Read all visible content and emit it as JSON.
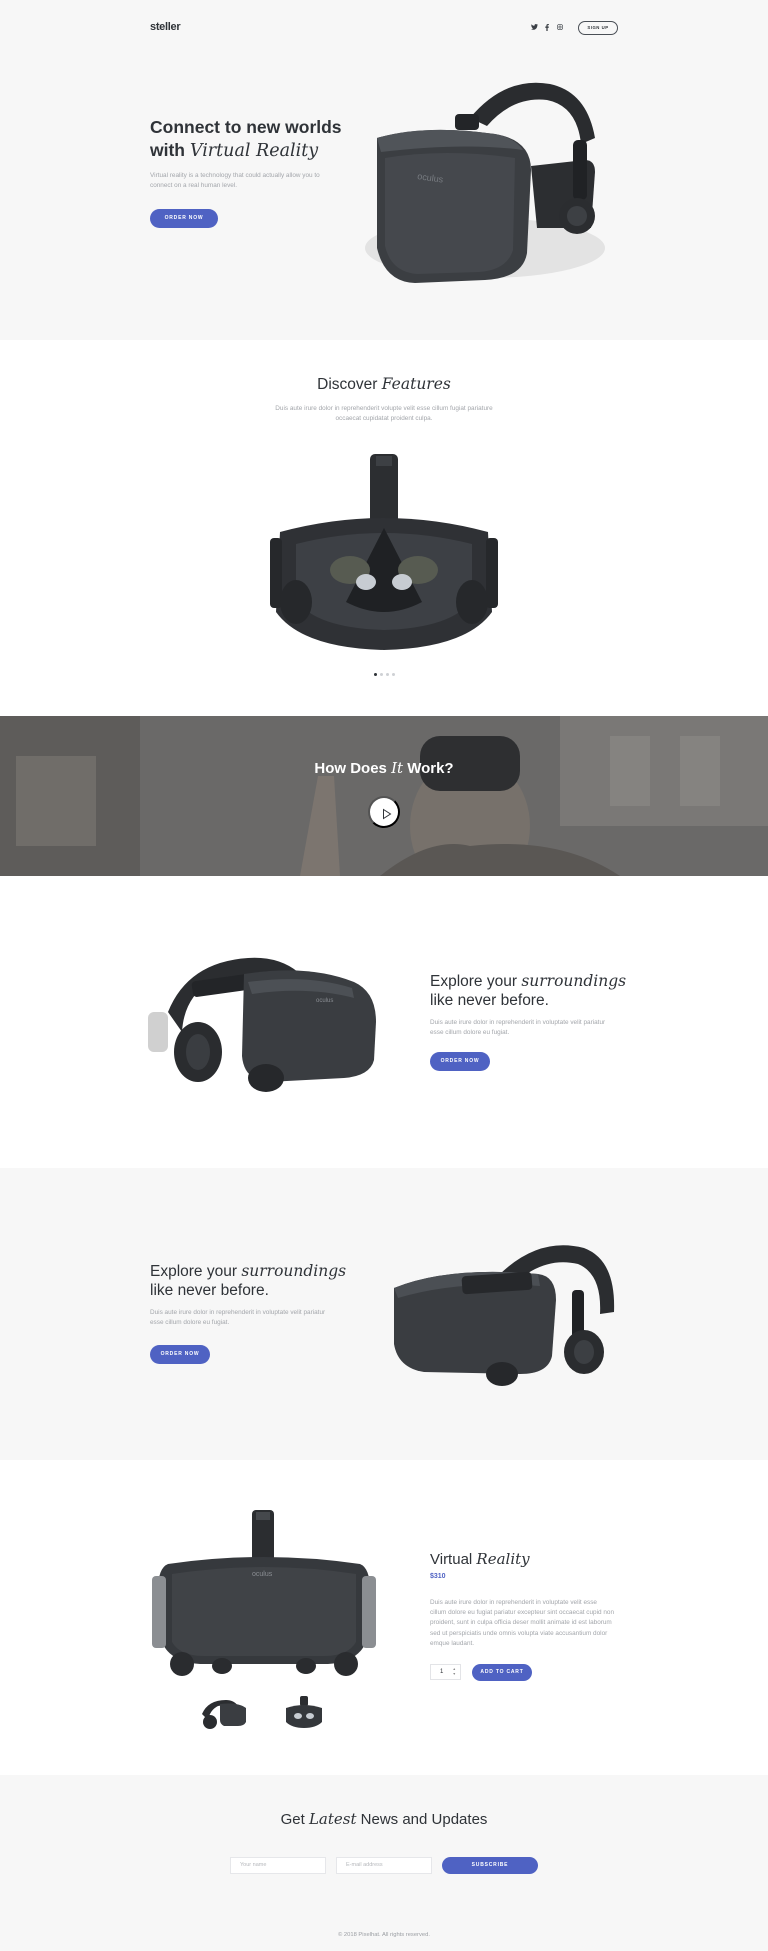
{
  "header": {
    "logo": "steller",
    "social": {
      "twitter": "twitter-icon",
      "facebook": "facebook-icon",
      "instagram": "instagram-icon"
    },
    "signup_label": "SIGN UP"
  },
  "hero": {
    "title_line1": "Connect to new worlds",
    "title_with": "with ",
    "title_italic": "Virtual Reality",
    "text": "Virtual reality is a technology that could actually allow you to connect on a real human level.",
    "button": "ORDER NOW"
  },
  "features": {
    "title_plain": "Discover ",
    "title_italic": "Features",
    "text": "Duis aute irure dolor in reprehenderit volupte velit esse cillum fugiat pariature occaecat cupidatat proident culpa.",
    "slides": 4,
    "active_slide": 0
  },
  "video": {
    "title_a": "How Does ",
    "title_italic": "It",
    "title_b": " Work?"
  },
  "explore1": {
    "title_a": "Explore your ",
    "title_italic": "surroundings",
    "title_line2": "like never before.",
    "text": "Duis aute irure dolor in reprehenderit in voluptate velit pariatur esse cillum dolore eu fugiat.",
    "button": "ORDER NOW"
  },
  "explore2": {
    "title_a": "Explore your ",
    "title_italic": "surroundings",
    "title_line2": "like never before.",
    "text": "Duis aute irure dolor in reprehenderit in voluptate velit pariatur esse cillum dolore eu fugiat.",
    "button": "ORDER NOW"
  },
  "product": {
    "title_plain": "Virtual ",
    "title_italic": "Reality",
    "price": "$310",
    "text": "Duis aute irure dolor in reprehenderit in voluptate velit esse cillum dolore eu fugiat pariatur excepteur sint occaecat cupid non proident, sunt in culpa officia deser mollit animate id est laborum sed ut perspiciatis unde omnis volupta viate accusantium dolor emque laudant.",
    "quantity": "1",
    "button": "ADD TO CART"
  },
  "newsletter": {
    "title_a": "Get ",
    "title_italic": "Latest",
    "title_b": " News and Updates",
    "name_placeholder": "Your name",
    "email_placeholder": "E-mail address",
    "button": "SUBSCRIBE"
  },
  "footer": {
    "copyright": "© 2018 Pixelhat. All rights reserved."
  },
  "colors": {
    "accent": "#4f62c3",
    "text": "#2f3338",
    "muted": "#a3a6ab",
    "bg": "#f7f7f7"
  }
}
